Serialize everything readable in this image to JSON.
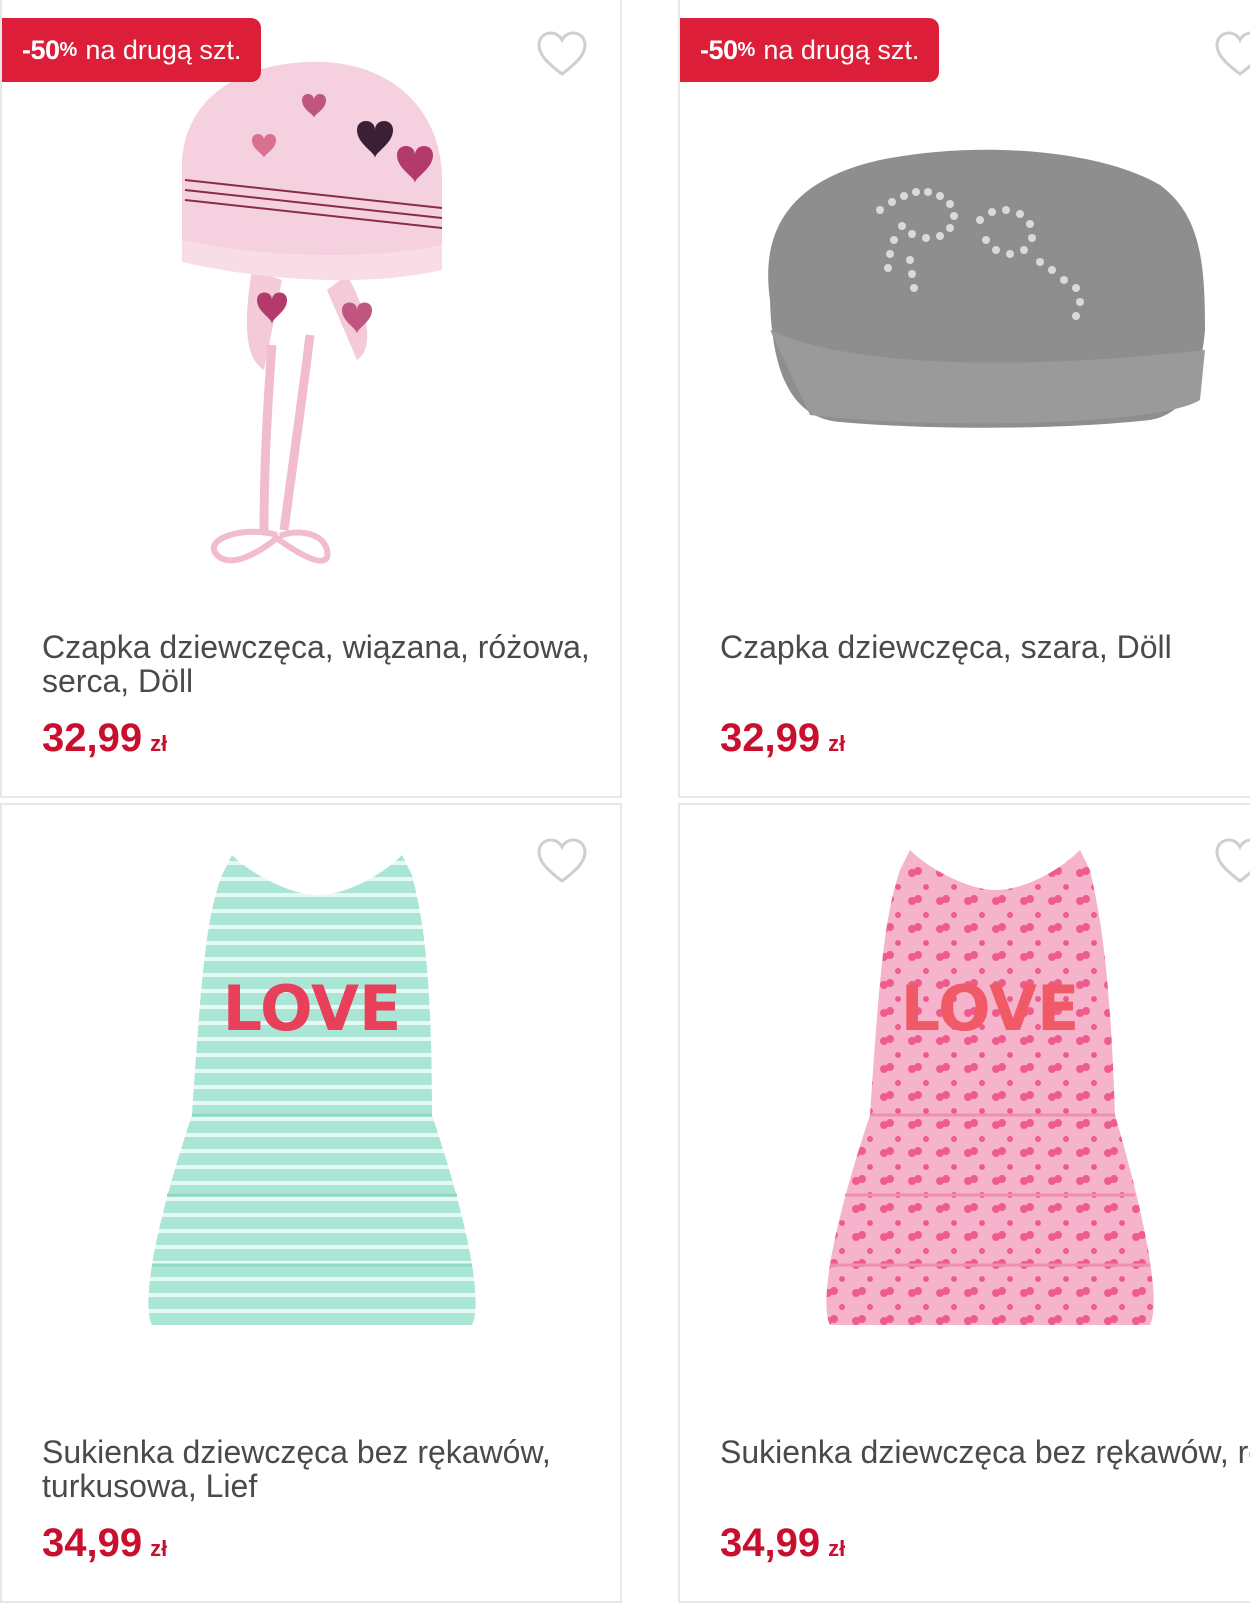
{
  "colors": {
    "accent": "#dc1e38",
    "price": "#c8102e"
  },
  "products": [
    {
      "badge_value": "-50",
      "badge_pct": "%",
      "badge_text": "na drugą szt.",
      "name": "Czapka dziewczęca, wiązana, różowa, serca, Döll",
      "price": "32,99",
      "currency": "zł",
      "favorite_icon": "heart-outline-icon"
    },
    {
      "badge_value": "-50",
      "badge_pct": "%",
      "badge_text": "na drugą szt.",
      "name": "Czapka dziewczęca, szara, Döll",
      "price": "32,99",
      "currency": "zł",
      "favorite_icon": "heart-outline-icon"
    },
    {
      "name": "Sukienka dziewczęca bez rękawów, turkusowa, Lief",
      "price": "34,99",
      "currency": "zł",
      "favorite_icon": "heart-outline-icon"
    },
    {
      "name": "Sukienka dziewczęca bez rękawów, różowa, Lief",
      "price": "34,99",
      "currency": "zł",
      "favorite_icon": "heart-outline-icon"
    }
  ],
  "images": {
    "dress_text": "LOVE"
  }
}
